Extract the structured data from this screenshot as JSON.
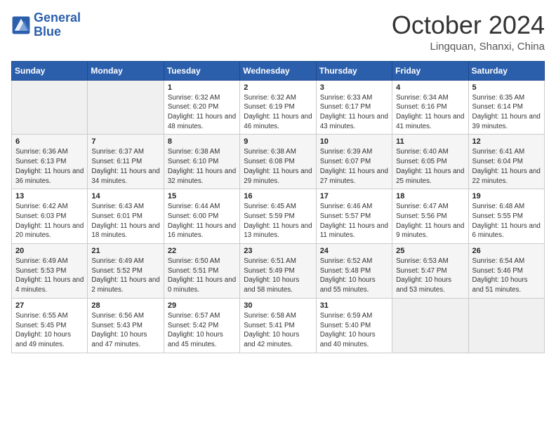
{
  "header": {
    "logo_line1": "General",
    "logo_line2": "Blue",
    "month_title": "October 2024",
    "location": "Lingquan, Shanxi, China"
  },
  "weekdays": [
    "Sunday",
    "Monday",
    "Tuesday",
    "Wednesday",
    "Thursday",
    "Friday",
    "Saturday"
  ],
  "weeks": [
    [
      null,
      null,
      {
        "day": 1,
        "sunrise": "6:32 AM",
        "sunset": "6:20 PM",
        "daylight": "11 hours and 48 minutes."
      },
      {
        "day": 2,
        "sunrise": "6:32 AM",
        "sunset": "6:19 PM",
        "daylight": "11 hours and 46 minutes."
      },
      {
        "day": 3,
        "sunrise": "6:33 AM",
        "sunset": "6:17 PM",
        "daylight": "11 hours and 43 minutes."
      },
      {
        "day": 4,
        "sunrise": "6:34 AM",
        "sunset": "6:16 PM",
        "daylight": "11 hours and 41 minutes."
      },
      {
        "day": 5,
        "sunrise": "6:35 AM",
        "sunset": "6:14 PM",
        "daylight": "11 hours and 39 minutes."
      }
    ],
    [
      {
        "day": 6,
        "sunrise": "6:36 AM",
        "sunset": "6:13 PM",
        "daylight": "11 hours and 36 minutes."
      },
      {
        "day": 7,
        "sunrise": "6:37 AM",
        "sunset": "6:11 PM",
        "daylight": "11 hours and 34 minutes."
      },
      {
        "day": 8,
        "sunrise": "6:38 AM",
        "sunset": "6:10 PM",
        "daylight": "11 hours and 32 minutes."
      },
      {
        "day": 9,
        "sunrise": "6:38 AM",
        "sunset": "6:08 PM",
        "daylight": "11 hours and 29 minutes."
      },
      {
        "day": 10,
        "sunrise": "6:39 AM",
        "sunset": "6:07 PM",
        "daylight": "11 hours and 27 minutes."
      },
      {
        "day": 11,
        "sunrise": "6:40 AM",
        "sunset": "6:05 PM",
        "daylight": "11 hours and 25 minutes."
      },
      {
        "day": 12,
        "sunrise": "6:41 AM",
        "sunset": "6:04 PM",
        "daylight": "11 hours and 22 minutes."
      }
    ],
    [
      {
        "day": 13,
        "sunrise": "6:42 AM",
        "sunset": "6:03 PM",
        "daylight": "11 hours and 20 minutes."
      },
      {
        "day": 14,
        "sunrise": "6:43 AM",
        "sunset": "6:01 PM",
        "daylight": "11 hours and 18 minutes."
      },
      {
        "day": 15,
        "sunrise": "6:44 AM",
        "sunset": "6:00 PM",
        "daylight": "11 hours and 16 minutes."
      },
      {
        "day": 16,
        "sunrise": "6:45 AM",
        "sunset": "5:59 PM",
        "daylight": "11 hours and 13 minutes."
      },
      {
        "day": 17,
        "sunrise": "6:46 AM",
        "sunset": "5:57 PM",
        "daylight": "11 hours and 11 minutes."
      },
      {
        "day": 18,
        "sunrise": "6:47 AM",
        "sunset": "5:56 PM",
        "daylight": "11 hours and 9 minutes."
      },
      {
        "day": 19,
        "sunrise": "6:48 AM",
        "sunset": "5:55 PM",
        "daylight": "11 hours and 6 minutes."
      }
    ],
    [
      {
        "day": 20,
        "sunrise": "6:49 AM",
        "sunset": "5:53 PM",
        "daylight": "11 hours and 4 minutes."
      },
      {
        "day": 21,
        "sunrise": "6:49 AM",
        "sunset": "5:52 PM",
        "daylight": "11 hours and 2 minutes."
      },
      {
        "day": 22,
        "sunrise": "6:50 AM",
        "sunset": "5:51 PM",
        "daylight": "11 hours and 0 minutes."
      },
      {
        "day": 23,
        "sunrise": "6:51 AM",
        "sunset": "5:49 PM",
        "daylight": "10 hours and 58 minutes."
      },
      {
        "day": 24,
        "sunrise": "6:52 AM",
        "sunset": "5:48 PM",
        "daylight": "10 hours and 55 minutes."
      },
      {
        "day": 25,
        "sunrise": "6:53 AM",
        "sunset": "5:47 PM",
        "daylight": "10 hours and 53 minutes."
      },
      {
        "day": 26,
        "sunrise": "6:54 AM",
        "sunset": "5:46 PM",
        "daylight": "10 hours and 51 minutes."
      }
    ],
    [
      {
        "day": 27,
        "sunrise": "6:55 AM",
        "sunset": "5:45 PM",
        "daylight": "10 hours and 49 minutes."
      },
      {
        "day": 28,
        "sunrise": "6:56 AM",
        "sunset": "5:43 PM",
        "daylight": "10 hours and 47 minutes."
      },
      {
        "day": 29,
        "sunrise": "6:57 AM",
        "sunset": "5:42 PM",
        "daylight": "10 hours and 45 minutes."
      },
      {
        "day": 30,
        "sunrise": "6:58 AM",
        "sunset": "5:41 PM",
        "daylight": "10 hours and 42 minutes."
      },
      {
        "day": 31,
        "sunrise": "6:59 AM",
        "sunset": "5:40 PM",
        "daylight": "10 hours and 40 minutes."
      },
      null,
      null
    ]
  ],
  "labels": {
    "sunrise": "Sunrise:",
    "sunset": "Sunset:",
    "daylight": "Daylight:"
  }
}
